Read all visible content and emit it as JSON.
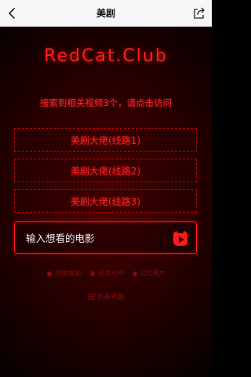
{
  "navbar": {
    "title": "美剧",
    "back_icon": "chevron-left-icon",
    "share_icon": "share-icon"
  },
  "main": {
    "logo": "RedCat.Club",
    "result_text": "搜索到相关视频3个，请点击访问",
    "routes": [
      {
        "label": "美剧大佬(线路1)"
      },
      {
        "label": "美剧大佬(线路2)"
      },
      {
        "label": "美剧大佬(线路3)"
      }
    ],
    "search": {
      "placeholder": "输入想看的电影",
      "button_icon": "cat-play-icon"
    },
    "links": [
      {
        "label": "热映电影",
        "icon": "fire-icon"
      },
      {
        "label": "安卓APP",
        "icon": "android-icon"
      },
      {
        "label": "IOS用户",
        "icon": "apple-icon"
      }
    ],
    "list_link": {
      "label": "列表界面",
      "icon": "list-icon"
    }
  },
  "colors": {
    "accent": "#ff2020",
    "dim_text": "#8a0a0a",
    "background": "#000000"
  }
}
